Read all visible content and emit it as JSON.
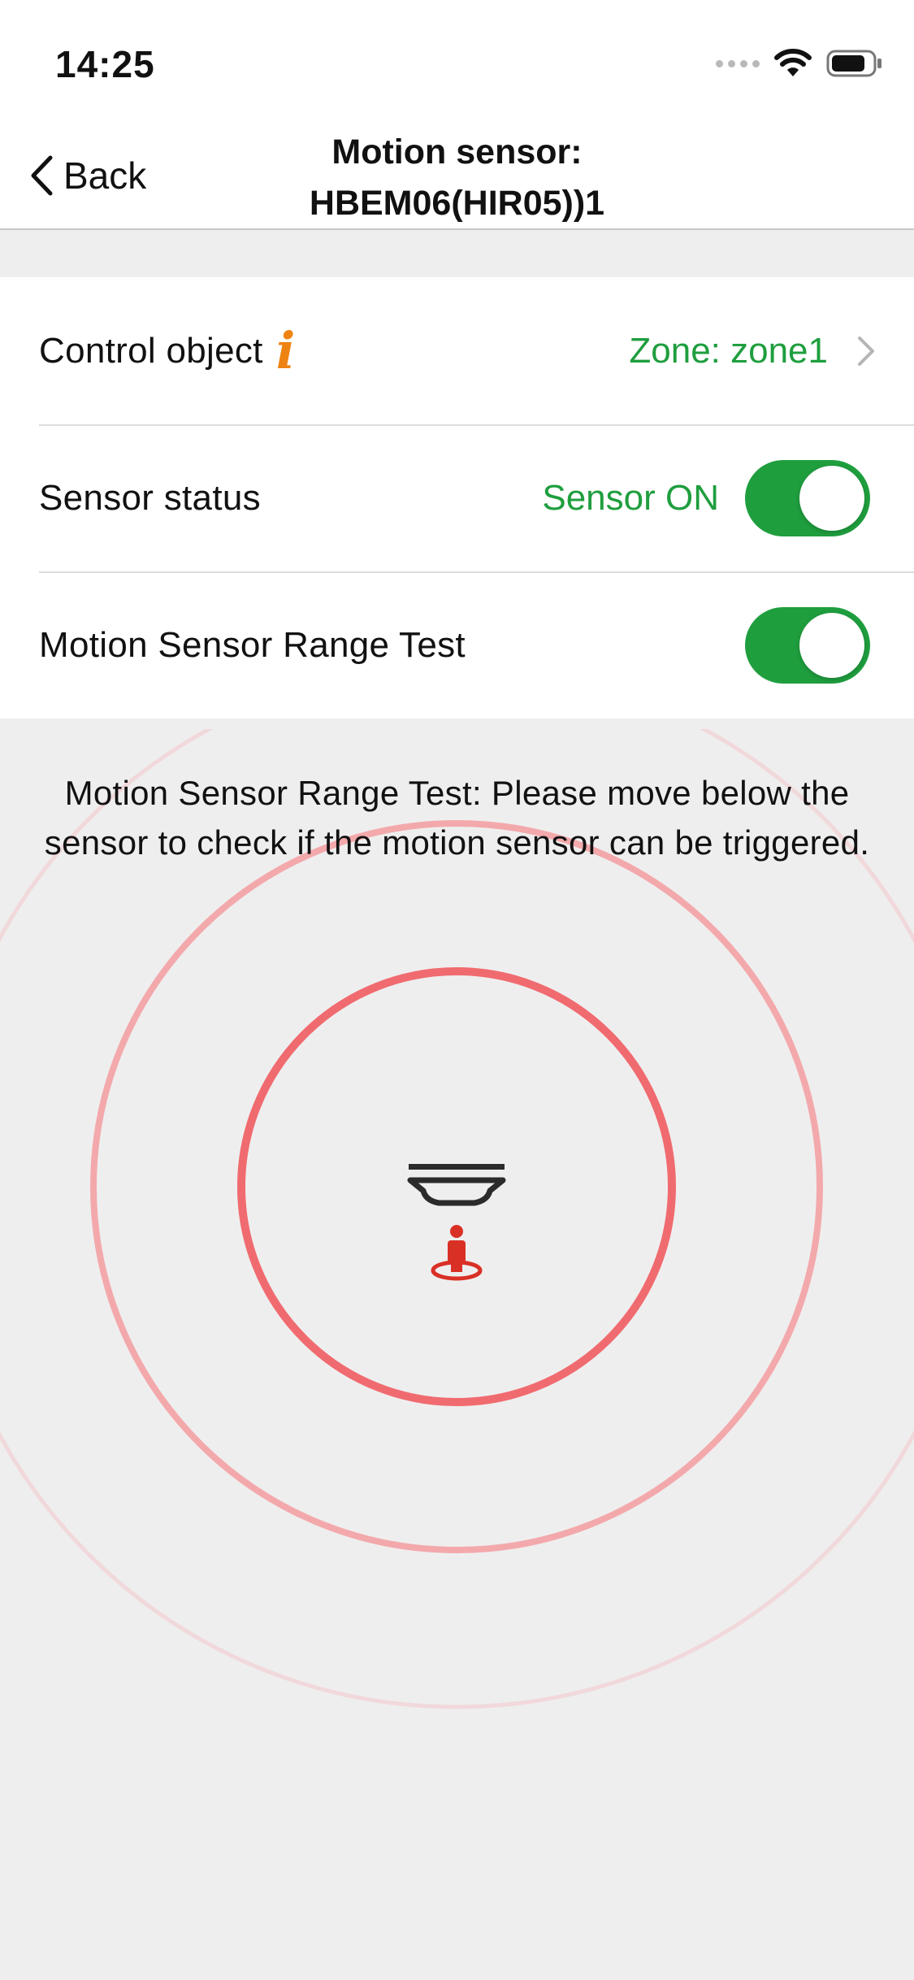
{
  "status_bar": {
    "time": "14:25",
    "icons": [
      "cellular-signal-icon",
      "wifi-icon",
      "battery-icon"
    ]
  },
  "nav": {
    "back_label": "Back",
    "title_line1": "Motion sensor:",
    "title_line2": "HBEM06(HIR05))1"
  },
  "rows": {
    "control_object": {
      "label": "Control object",
      "value": "Zone: zone1",
      "icon": "info-icon"
    },
    "sensor_status": {
      "label": "Sensor status",
      "value": "Sensor ON",
      "toggle_on": true
    },
    "range_test": {
      "label": "Motion Sensor Range Test",
      "toggle_on": true
    }
  },
  "range_test_message": "Motion Sensor Range Test: Please move below the sensor to check if the motion sensor can be triggered.",
  "colors": {
    "accent_green": "#1f9e3e",
    "info_orange": "#ee8312",
    "ring_red": "#f06b6f",
    "person_red": "#d93025"
  }
}
